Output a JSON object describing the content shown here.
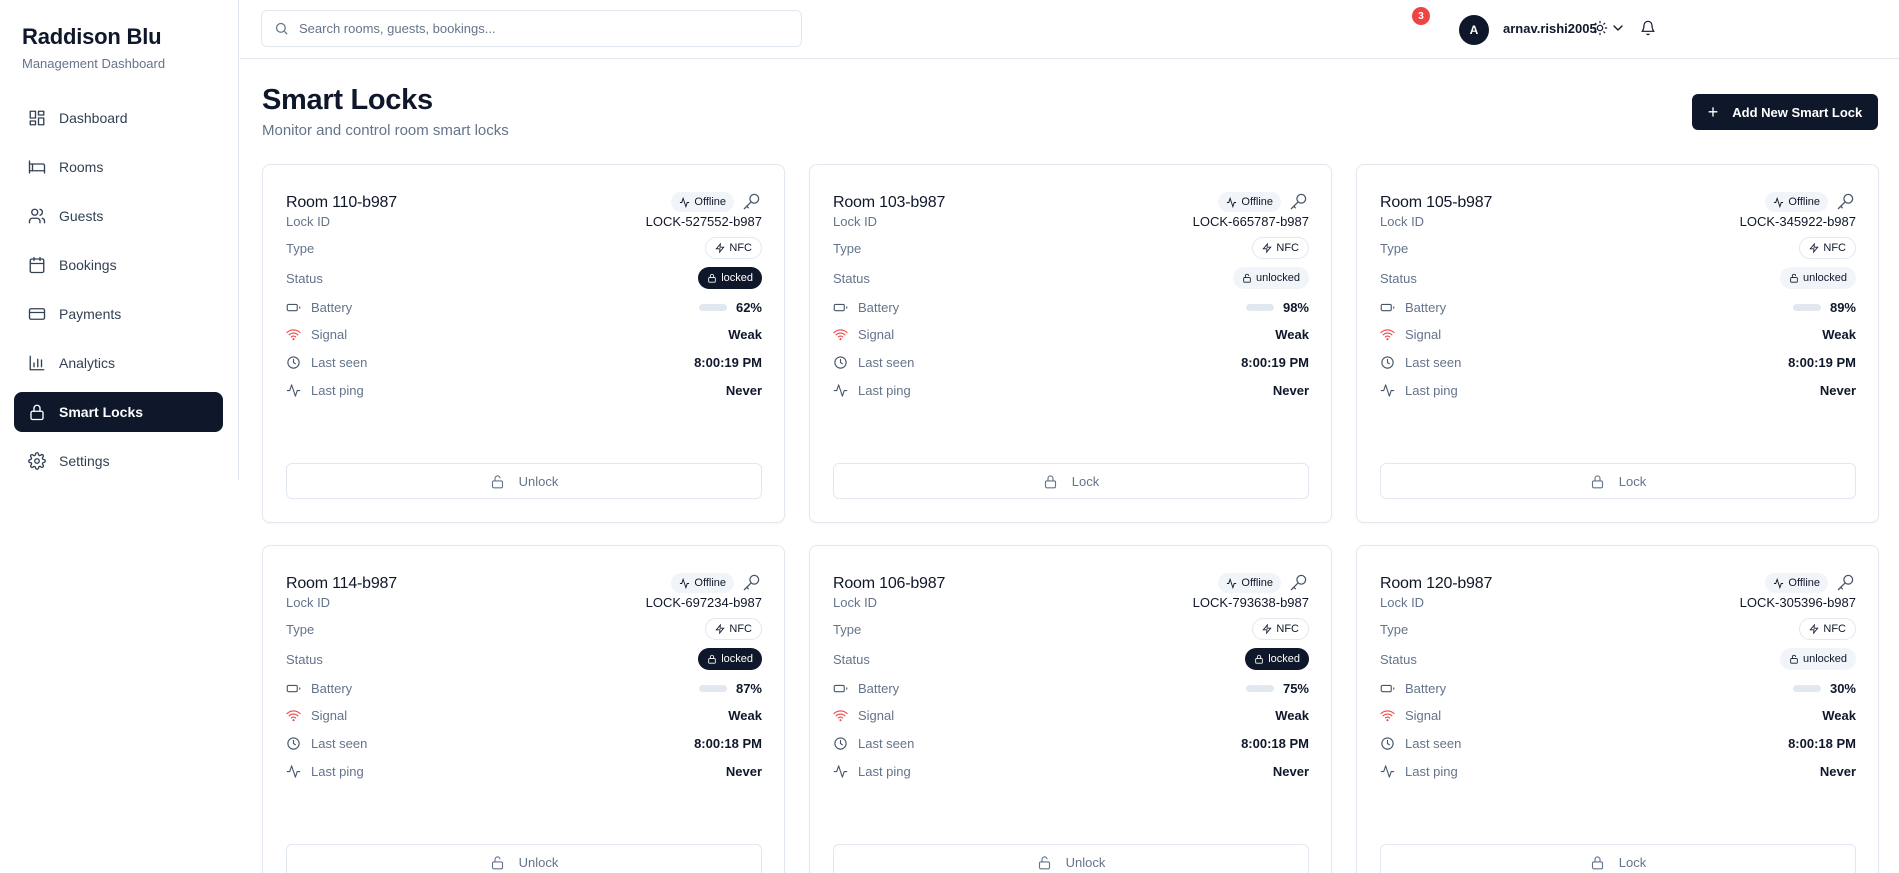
{
  "brand": {
    "title": "Raddison Blu",
    "subtitle": "Management Dashboard"
  },
  "sidebar": {
    "items": [
      {
        "label": "Dashboard",
        "icon": "dashboard-icon"
      },
      {
        "label": "Rooms",
        "icon": "bed-icon"
      },
      {
        "label": "Guests",
        "icon": "users-icon"
      },
      {
        "label": "Bookings",
        "icon": "calendar-icon"
      },
      {
        "label": "Payments",
        "icon": "credit-card-icon"
      },
      {
        "label": "Analytics",
        "icon": "bar-chart-icon"
      },
      {
        "label": "Smart Locks",
        "icon": "lock-icon",
        "active": true
      },
      {
        "label": "Settings",
        "icon": "gear-icon"
      }
    ]
  },
  "topbar": {
    "search_placeholder": "Search rooms, guests, bookings...",
    "notification_count": "3",
    "avatar_initial": "A",
    "username": "arnav.rishi2005"
  },
  "page": {
    "title": "Smart Locks",
    "subtitle": "Monitor and control room smart locks",
    "add_button": "Add New Smart Lock"
  },
  "labels": {
    "lock_id": "Lock ID",
    "type": "Type",
    "status": "Status",
    "battery": "Battery",
    "signal": "Signal",
    "last_seen": "Last seen",
    "last_ping": "Last ping"
  },
  "colors": {
    "primary": "#0f172a",
    "battery_good": "#22c55e",
    "battery_low": "#eab308",
    "signal_weak": "#ef4444",
    "notification_badge": "#ef4444"
  },
  "locks": [
    {
      "room": "Room 110-b987",
      "connection": "Offline",
      "lock_id": "LOCK-527552-b987",
      "type": "NFC",
      "status": "locked",
      "battery": "62%",
      "battery_fraction": 0.62,
      "battery_color": "#22c55e",
      "signal": "Weak",
      "last_seen": "8:00:19 PM",
      "last_ping": "Never",
      "action": "Unlock"
    },
    {
      "room": "Room 103-b987",
      "connection": "Offline",
      "lock_id": "LOCK-665787-b987",
      "type": "NFC",
      "status": "unlocked",
      "battery": "98%",
      "battery_fraction": 0.98,
      "battery_color": "#22c55e",
      "signal": "Weak",
      "last_seen": "8:00:19 PM",
      "last_ping": "Never",
      "action": "Lock"
    },
    {
      "room": "Room 105-b987",
      "connection": "Offline",
      "lock_id": "LOCK-345922-b987",
      "type": "NFC",
      "status": "unlocked",
      "battery": "89%",
      "battery_fraction": 0.89,
      "battery_color": "#22c55e",
      "signal": "Weak",
      "last_seen": "8:00:19 PM",
      "last_ping": "Never",
      "action": "Lock"
    },
    {
      "room": "Room 114-b987",
      "connection": "Offline",
      "lock_id": "LOCK-697234-b987",
      "type": "NFC",
      "status": "locked",
      "battery": "87%",
      "battery_fraction": 0.87,
      "battery_color": "#22c55e",
      "signal": "Weak",
      "last_seen": "8:00:18 PM",
      "last_ping": "Never",
      "action": "Unlock"
    },
    {
      "room": "Room 106-b987",
      "connection": "Offline",
      "lock_id": "LOCK-793638-b987",
      "type": "NFC",
      "status": "locked",
      "battery": "75%",
      "battery_fraction": 0.75,
      "battery_color": "#22c55e",
      "signal": "Weak",
      "last_seen": "8:00:18 PM",
      "last_ping": "Never",
      "action": "Unlock"
    },
    {
      "room": "Room 120-b987",
      "connection": "Offline",
      "lock_id": "LOCK-305396-b987",
      "type": "NFC",
      "status": "unlocked",
      "battery": "30%",
      "battery_fraction": 0.3,
      "battery_color": "#eab308",
      "signal": "Weak",
      "last_seen": "8:00:18 PM",
      "last_ping": "Never",
      "action": "Lock"
    }
  ]
}
